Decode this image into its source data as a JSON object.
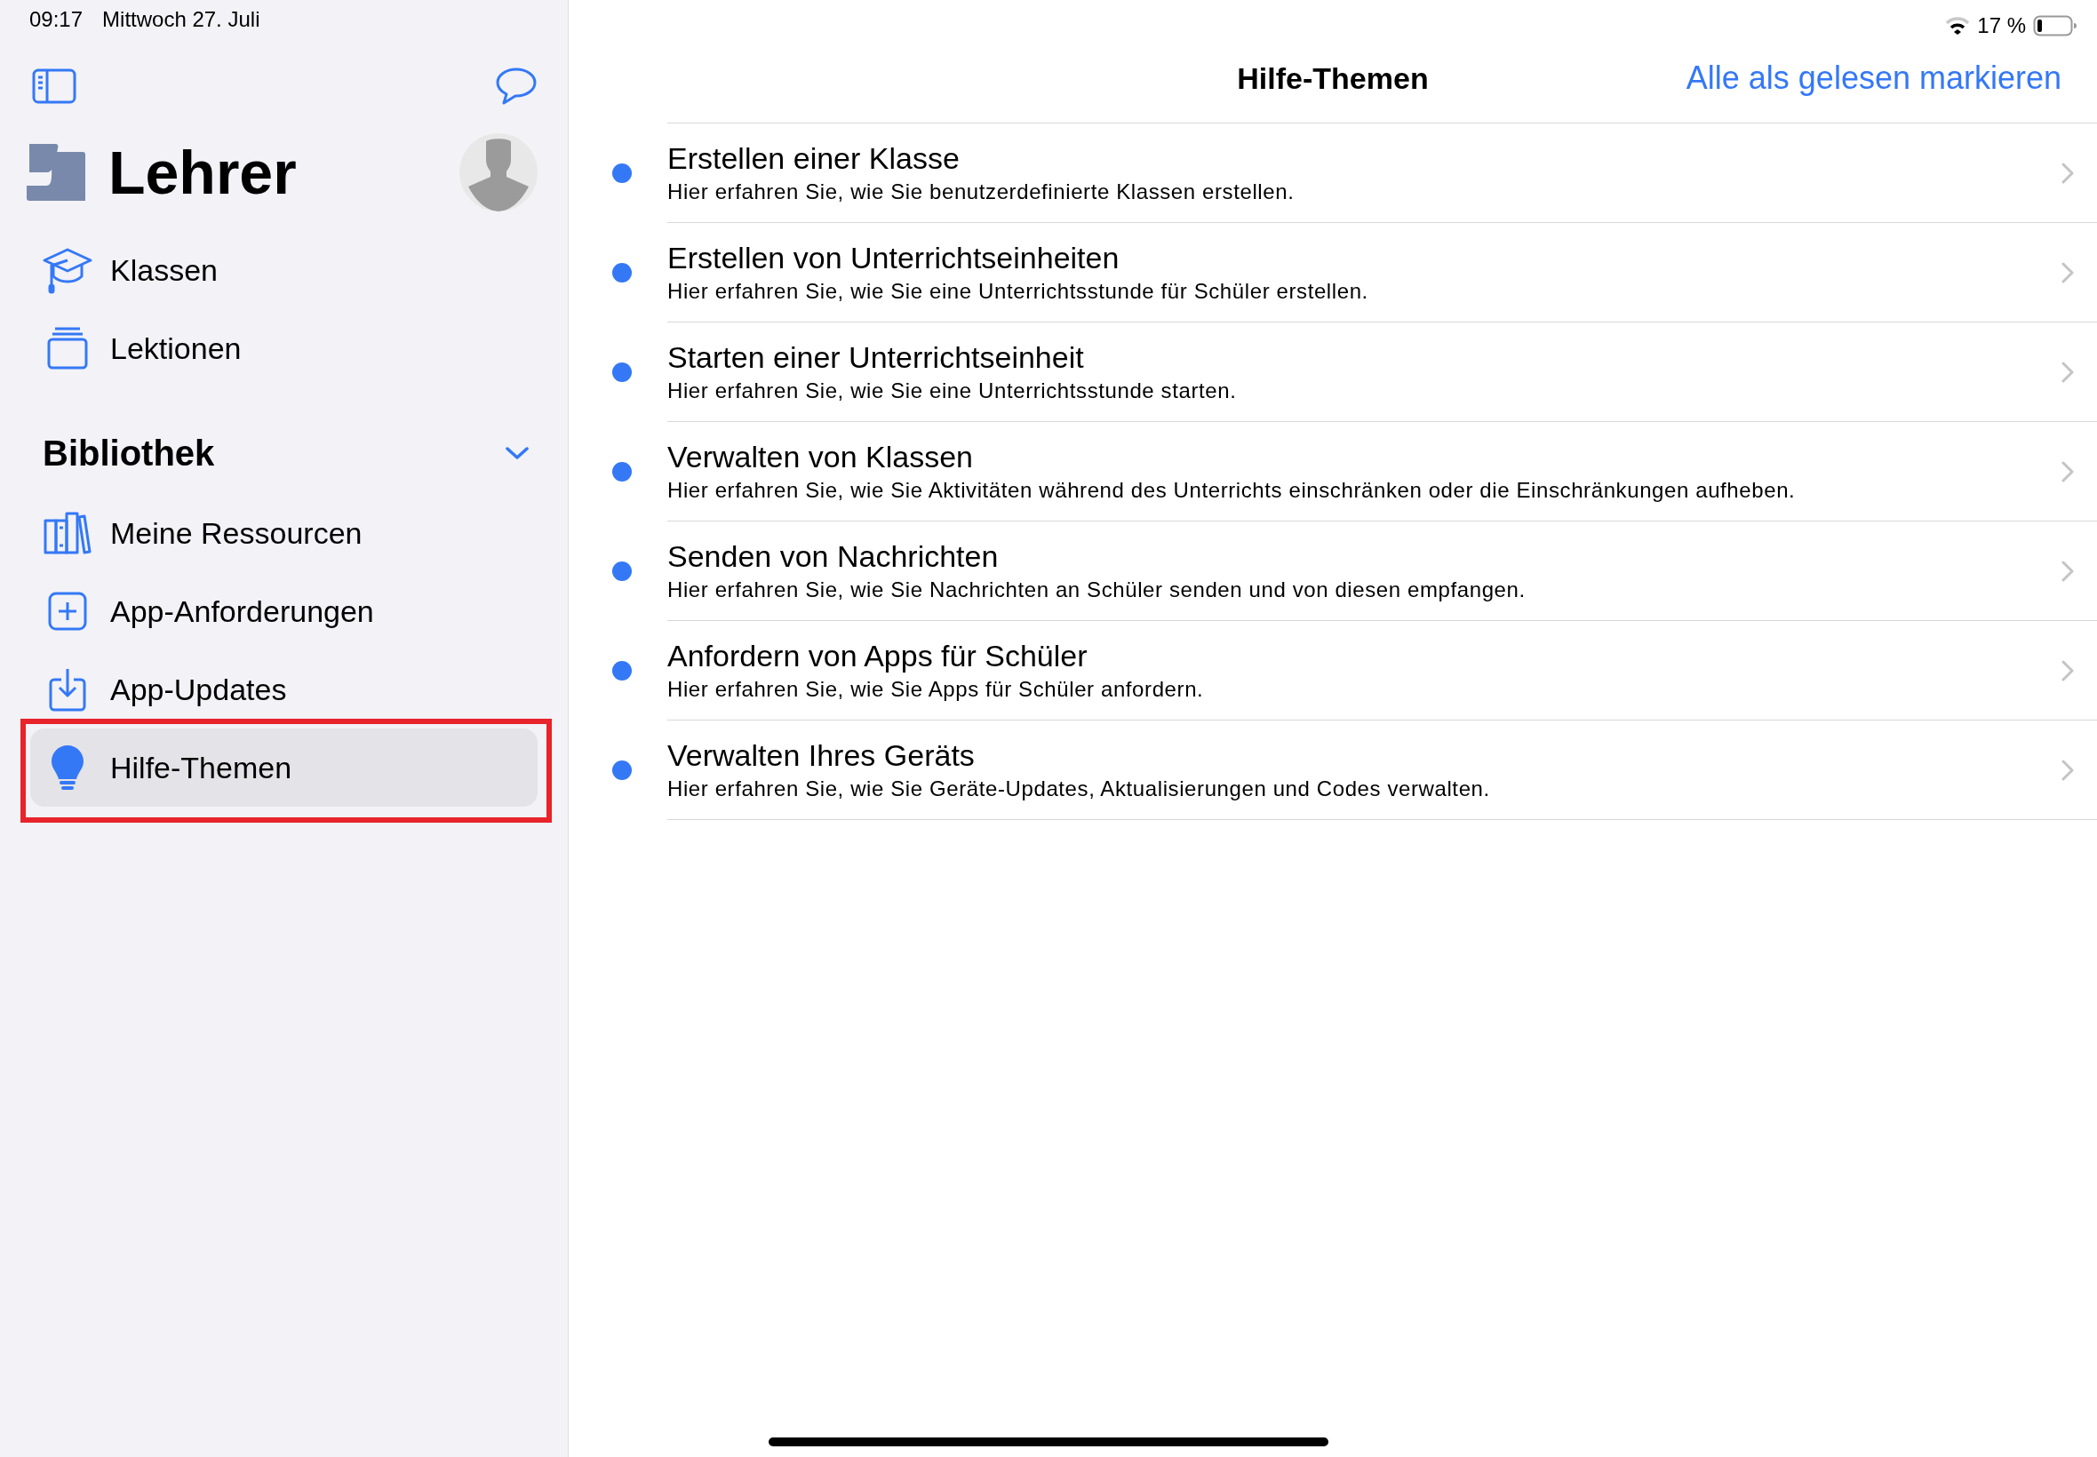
{
  "status_bar": {
    "time": "09:17",
    "date": "Mittwoch 27. Juli",
    "battery": "17 %"
  },
  "sidebar": {
    "title": "Lehrer",
    "items": [
      {
        "label": "Klassen",
        "selected": false
      },
      {
        "label": "Lektionen",
        "selected": false
      }
    ],
    "section": {
      "title": "Bibliothek",
      "expanded": true,
      "items": [
        {
          "label": "Meine Ressourcen",
          "selected": false
        },
        {
          "label": "App-Anforderungen",
          "selected": false
        },
        {
          "label": "App-Updates",
          "selected": false
        },
        {
          "label": "Hilfe-Themen",
          "selected": true
        }
      ]
    }
  },
  "content": {
    "title": "Hilfe-Themen",
    "action": "Alle als gelesen markieren",
    "topics": [
      {
        "title": "Erstellen einer Klasse",
        "subtitle": "Hier erfahren Sie, wie Sie benutzerdefinierte Klassen erstellen.",
        "unread": true
      },
      {
        "title": "Erstellen von Unterrichtseinheiten",
        "subtitle": "Hier erfahren Sie, wie Sie eine Unterrichtsstunde für Schüler erstellen.",
        "unread": true
      },
      {
        "title": "Starten einer Unterrichtseinheit",
        "subtitle": "Hier erfahren Sie, wie Sie eine Unterrichtsstunde starten.",
        "unread": true
      },
      {
        "title": "Verwalten von Klassen",
        "subtitle": "Hier erfahren Sie, wie Sie Aktivitäten während des Unterrichts einschränken oder die Einschränkungen aufheben.",
        "unread": true
      },
      {
        "title": "Senden von Nachrichten",
        "subtitle": "Hier erfahren Sie, wie Sie Nachrichten an Schüler senden und von diesen empfangen.",
        "unread": true
      },
      {
        "title": "Anfordern von Apps für Schüler",
        "subtitle": "Hier erfahren Sie, wie Sie Apps für Schüler anfordern.",
        "unread": true
      },
      {
        "title": "Verwalten Ihres Geräts",
        "subtitle": "Hier erfahren Sie, wie Sie Geräte-Updates, Aktualisierungen und Codes verwalten.",
        "unread": true
      }
    ]
  }
}
